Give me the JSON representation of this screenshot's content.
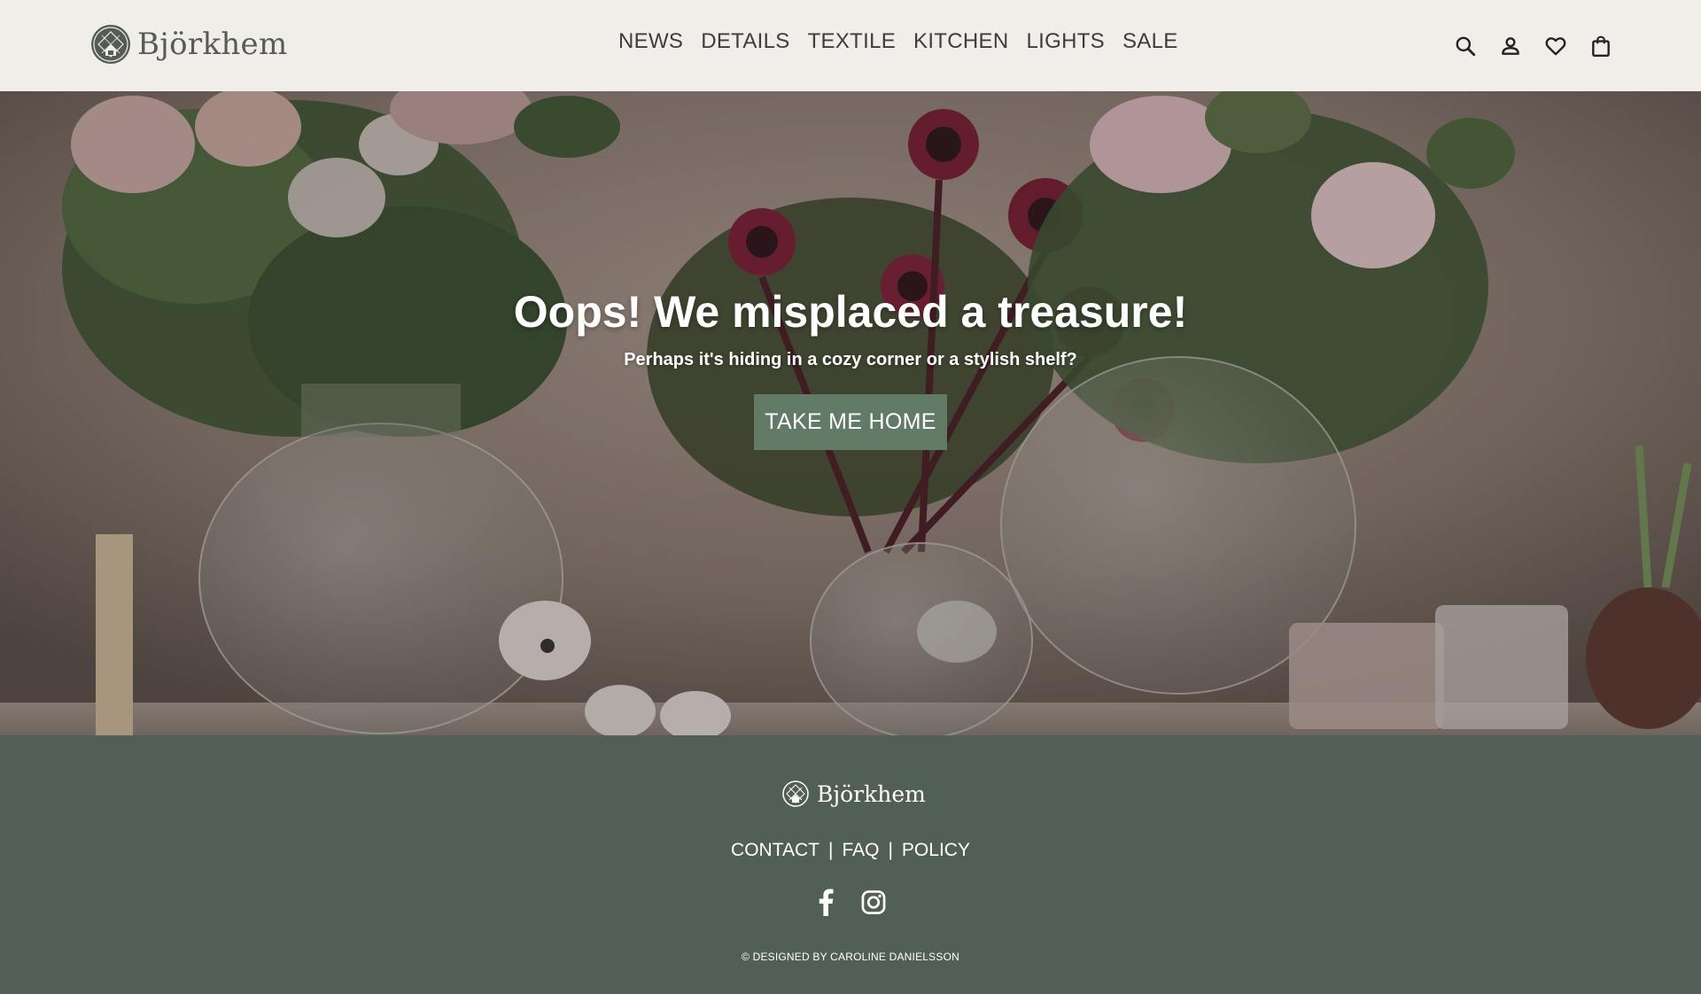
{
  "brand": {
    "name": "Björkhem"
  },
  "nav": {
    "items": [
      {
        "label": "NEWS"
      },
      {
        "label": "DETAILS"
      },
      {
        "label": "TEXTILE"
      },
      {
        "label": "KITCHEN"
      },
      {
        "label": "LIGHTS"
      },
      {
        "label": "SALE"
      }
    ]
  },
  "tools": {
    "icons": [
      "search-icon",
      "account-icon",
      "heart-icon",
      "bag-icon"
    ]
  },
  "hero": {
    "title": "Oops! We misplaced a treasure!",
    "subtitle": "Perhaps it's hiding in a cozy corner or a stylish shelf?",
    "button_label": "TAKE ME HOME"
  },
  "footer": {
    "brand": "Björkhem",
    "links": [
      {
        "label": "CONTACT"
      },
      {
        "label": "FAQ"
      },
      {
        "label": "POLICY"
      }
    ],
    "separator": "|",
    "social_icons": [
      "facebook-icon",
      "instagram-icon"
    ],
    "copyright": "© DESIGNED BY CAROLINE DANIELSSON"
  },
  "colors": {
    "header_bg": "#f1ede8",
    "button_bg": "#627b66",
    "footer_bg": "#525f56",
    "text_dark": "#3d3d3d"
  }
}
